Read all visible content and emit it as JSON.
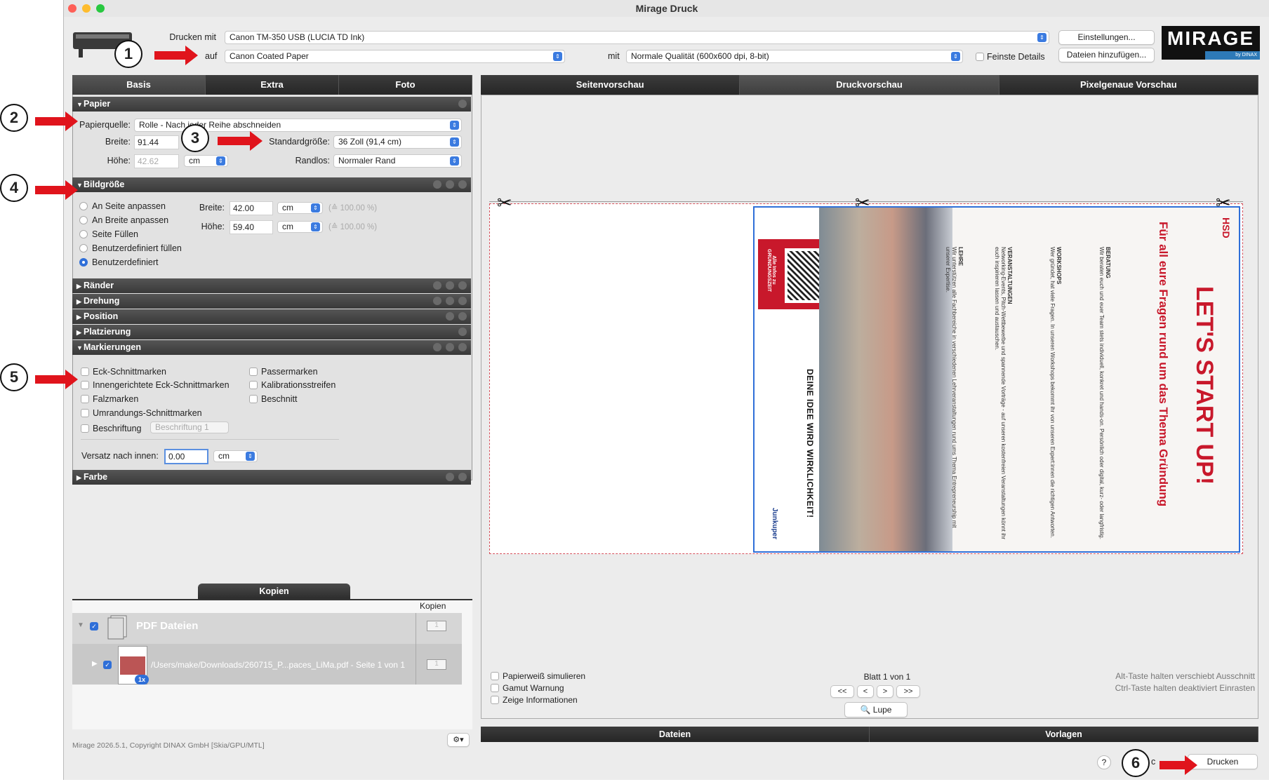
{
  "window": {
    "title": "Mirage Druck"
  },
  "top": {
    "print_with_label": "Drucken mit",
    "printer": "Canon TM-350 USB (LUCIA TD Ink)",
    "on_label": "auf",
    "paper": "Canon Coated Paper",
    "with_label": "mit",
    "quality": "Normale Qualität (600x600 dpi, 8-bit)",
    "fine_details_label": "Feinste Details",
    "settings_button": "Einstellungen...",
    "add_files_button": "Dateien hinzufügen...",
    "logo_text": "MIRAGE",
    "logo_sub": "by DINAX"
  },
  "left_tabs": [
    "Basis",
    "Extra",
    "Foto"
  ],
  "papier": {
    "title": "Papier",
    "source_label": "Papierquelle:",
    "source_value": "Rolle - Nach jeder Reihe abschneiden",
    "width_label": "Breite:",
    "width_value": "91.44",
    "height_label": "Höhe:",
    "height_value": "42.62",
    "height_unit": "cm",
    "std_size_label": "Standardgröße:",
    "std_size_value": "36 Zoll (91,4 cm)",
    "borderless_label": "Randlos:",
    "borderless_value": "Normaler Rand"
  },
  "bildgroesse": {
    "title": "Bildgröße",
    "options": [
      "An Seite anpassen",
      "An Breite anpassen",
      "Seite Füllen",
      "Benutzerdefiniert füllen",
      "Benutzerdefiniert"
    ],
    "width_label": "Breite:",
    "width_value": "42.00",
    "width_unit": "cm",
    "width_pct": "(≙ 100.00 %)",
    "height_label": "Höhe:",
    "height_value": "59.40",
    "height_unit": "cm",
    "height_pct": "(≙ 100.00 %)"
  },
  "sections": {
    "raender": "Ränder",
    "drehung": "Drehung",
    "position": "Position",
    "platzierung": "Platzierung",
    "markierungen": "Markierungen",
    "farbe": "Farbe"
  },
  "markierungen": {
    "left": [
      "Eck-Schnittmarken",
      "Innengerichtete Eck-Schnittmarken",
      "Falzmarken",
      "Umrandungs-Schnittmarken",
      "Beschriftung"
    ],
    "right": [
      "Passermarken",
      "Kalibrationsstreifen",
      "Beschnitt"
    ],
    "beschriftung_value": "Beschriftung 1",
    "offset_label": "Versatz nach innen:",
    "offset_value": "0.00",
    "offset_unit": "cm"
  },
  "copies": {
    "tab": "Kopien",
    "col_header": "Kopien",
    "group": "PDF Dateien",
    "file": "/Users/make/Downloads/260715_P...paces_LiMa.pdf - Seite 1 von 1",
    "badge": "1x",
    "group_count": "1",
    "file_count": "1"
  },
  "footer": {
    "copyright": "Mirage 2026.5.1, Copyright DINAX GmbH [Skia/GPU/MTL]"
  },
  "preview_tabs": [
    "Seitenvorschau",
    "Druckvorschau",
    "Pixelgenaue Vorschau"
  ],
  "preview_opts": [
    "Papierweiß simulieren",
    "Gamut Warnung",
    "Zeige Informationen"
  ],
  "pager": {
    "label": "Blatt 1 von 1",
    "first": "<<",
    "prev": "<",
    "next": ">",
    "last": ">>",
    "zoom": "Lupe"
  },
  "hints": [
    "Alt-Taste halten verschiebt Ausschnitt",
    "Ctrl-Taste halten deaktiviert Einrasten"
  ],
  "bottom_tabs": [
    "Dateien",
    "Vorlagen"
  ],
  "actions": {
    "help": "?",
    "cancel_fragment": "c",
    "print_button": "Drucken"
  },
  "annotations": [
    "1",
    "2",
    "3",
    "4",
    "5",
    "6"
  ],
  "poster": {
    "headline": "LET'S START UP!",
    "subline": "Für all eure Fragen rund um das Thema Gründung",
    "hsd": "HSD",
    "b1": "BERATUNG",
    "t1": "Wir beraten euch und euer Team stets individuell, konkret und hands-on. Persönlich oder digital, kurz- oder langfristig.",
    "b2": "WORKSHOPS",
    "t2": "Wer gründet, hat viele Fragen. In unseren Workshops bekommt ihr von unseren Expert:innen die richtigen Antworten.",
    "b3": "VERANSTALTUNGEN",
    "t3": "Networking-Events, Pitch-Wettbewerbe und spannende Vorträge - auf unseren kostenfreien Veranstaltungen könnt ihr euch inspirieren lassen und austauschen.",
    "b4": "LEHRE",
    "t4": "Wir unterstützen alle Fachbereiche in verschiedenen Lehrveranstaltungen rund ums Thema Entrepreneurship mit unserer Expertise.",
    "tagline": "DEINE IDEE WIRD WIRKLICHKEIT!",
    "qr_label": "Alle Infos zu GRÜNDUNGSZEIT",
    "logo_exist": "exist",
    "logo_jk": "Junkuper"
  },
  "colors": {
    "accent": "#2f6fd8",
    "arrow": "#e0141c",
    "poster_red": "#c8182b"
  }
}
